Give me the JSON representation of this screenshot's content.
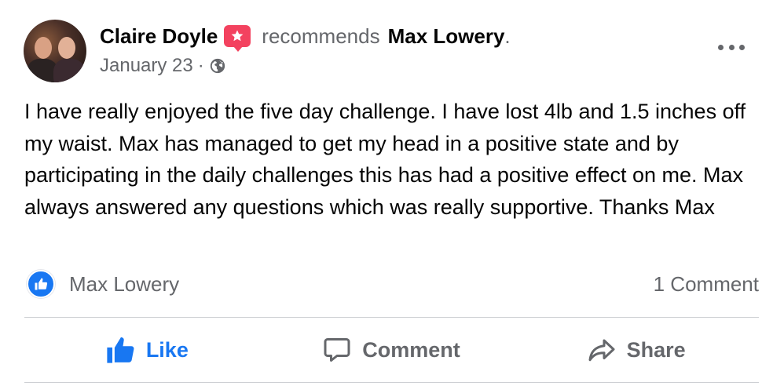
{
  "post": {
    "author": "Claire Doyle",
    "verb": "recommends",
    "target": "Max Lowery",
    "period": ".",
    "date": "January 23",
    "separator": "·",
    "audience_icon": "globe-icon",
    "body": "I have really enjoyed the five day challenge. I have lost 4lb and 1.5 inches off my waist. Max has managed to get my head in a positive state and by participating in the daily challenges this has had a positive effect on me. Max always answered any questions which was really supportive. Thanks Max"
  },
  "reactions": {
    "icon": "thumbs-up-icon",
    "reactor": "Max Lowery",
    "comment_count": "1 Comment"
  },
  "actions": {
    "like": "Like",
    "comment": "Comment",
    "share": "Share"
  },
  "colors": {
    "accent": "#1877f2",
    "recommend_badge": "#f3425f",
    "secondary_text": "#65676b",
    "divider": "#ced0d4"
  }
}
